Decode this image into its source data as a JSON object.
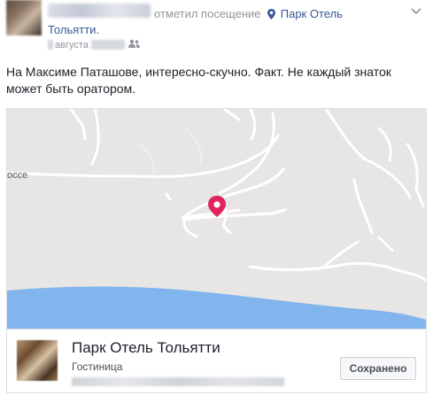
{
  "header": {
    "action_text": "отметил посещение",
    "place_link": "Парк Отель",
    "place_link_cont": "Тольятти.",
    "date_text": "августа",
    "privacy_icon": "friends-icon",
    "menu_icon": "chevron-down-icon"
  },
  "post": {
    "text": "На Максиме Паташове, интересно-скучно. Факт. Не каждый знаток может быть оратором."
  },
  "map": {
    "road_label": "оссе",
    "marker_color": "#e0245e",
    "water_color": "#82b4ee"
  },
  "place": {
    "name": "Парк Отель Тольятти",
    "category": "Гостиница",
    "save_label": "Сохранено"
  }
}
